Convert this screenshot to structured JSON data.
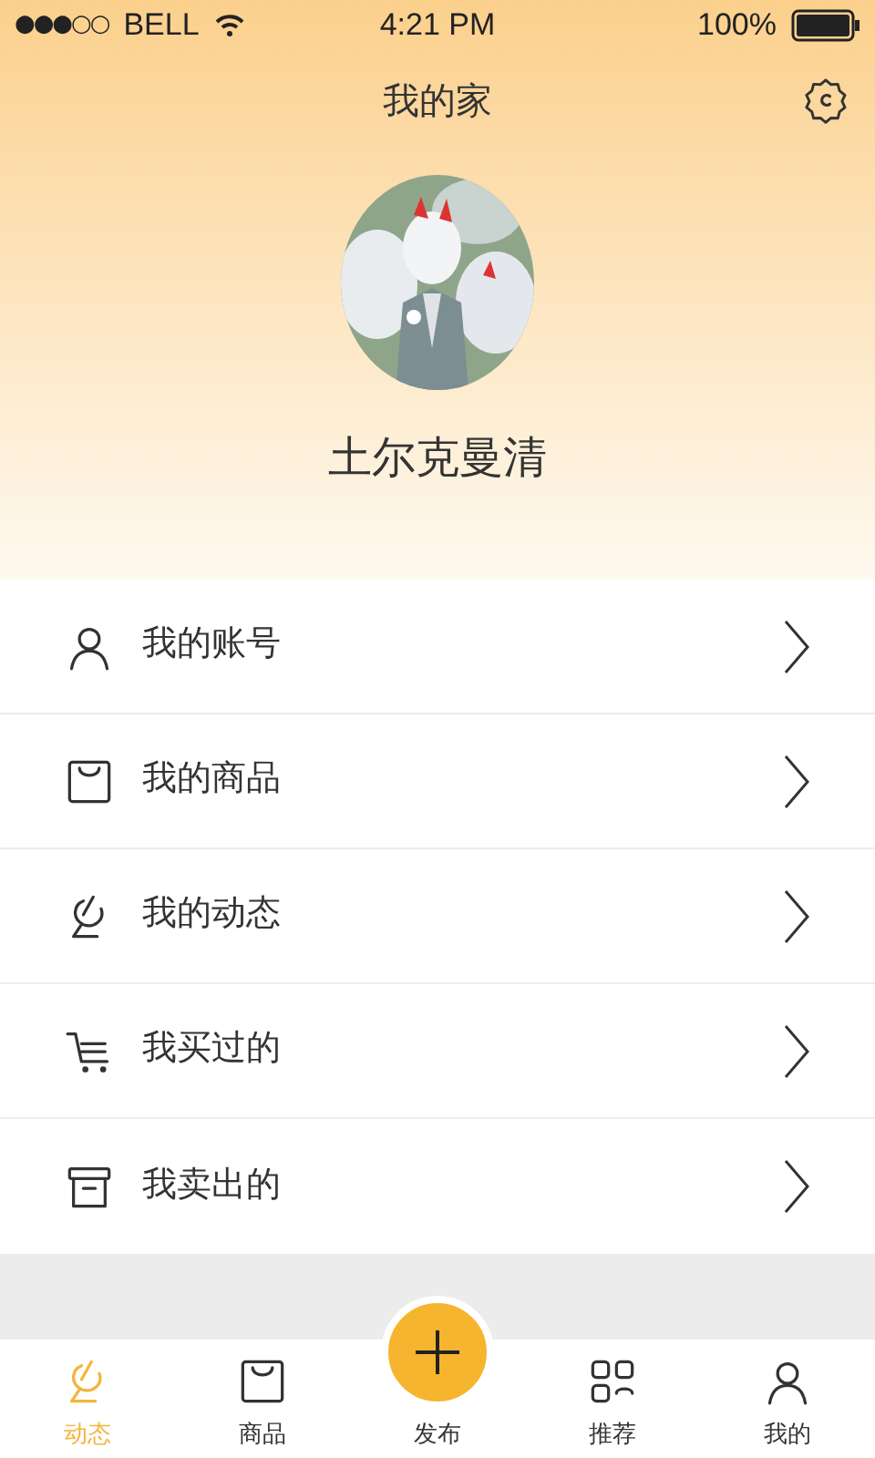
{
  "status_bar": {
    "signal": "●●●○○",
    "carrier": "BELL",
    "time": "4:21 PM",
    "battery": "100%"
  },
  "header": {
    "title": "我的家"
  },
  "profile": {
    "name": "土尔克曼清"
  },
  "menu": [
    {
      "label": "我的账号"
    },
    {
      "label": "我的商品"
    },
    {
      "label": "我的动态"
    },
    {
      "label": "我买过的"
    },
    {
      "label": "我卖出的"
    }
  ],
  "tabs": [
    {
      "kind": "tab",
      "label": "动态",
      "selected": true
    },
    {
      "kind": "tab",
      "label": "商品",
      "selected": false
    },
    {
      "kind": "action",
      "label": "发布",
      "selected": false
    },
    {
      "kind": "tab",
      "label": "推荐",
      "selected": false
    },
    {
      "kind": "tab",
      "label": "我的",
      "selected": false
    }
  ]
}
